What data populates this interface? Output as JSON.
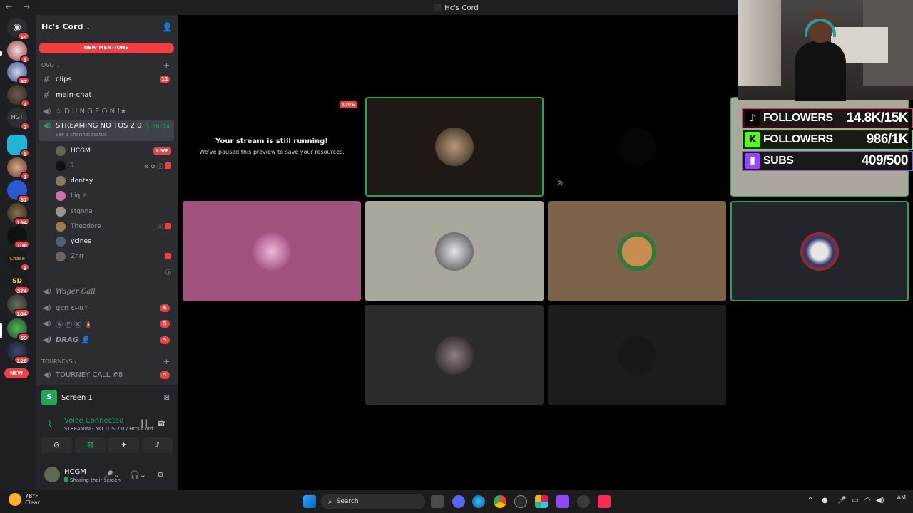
{
  "titlebar": {
    "nav": "← →",
    "title": "Hc's Cord"
  },
  "guilds": {
    "badges": [
      "54",
      "1",
      "97",
      "1",
      "2",
      "1",
      "1",
      "87",
      "194",
      "108",
      "9",
      "374",
      "104",
      "59",
      "126"
    ],
    "new_label": "NEW"
  },
  "server": {
    "name": "Hc's Cord",
    "new_mentions": "NEW MENTIONS",
    "category_ovo": "OVO",
    "category_tourneys": "TOURNEYS",
    "channels": [
      {
        "name": "clips",
        "count": "11"
      },
      {
        "name": "main-chat"
      },
      {
        "name": "☆ D U N G E O N !★"
      }
    ],
    "active_channel": {
      "name": "STREAMING NO TOS 2.0",
      "status": "Set a channel status",
      "timer": "3:00:24"
    },
    "users": [
      {
        "name": "HCGM",
        "live": "LIVE"
      },
      {
        "name": "?"
      },
      {
        "name": "dontay"
      },
      {
        "name": "Liq ⚡"
      },
      {
        "name": "stqnna"
      },
      {
        "name": "Theodore"
      },
      {
        "name": "ycines"
      },
      {
        "name": "Zhrr"
      }
    ],
    "voice_channels": [
      {
        "name": "Wager Call"
      },
      {
        "name": "ցєη εнαт",
        "count": "6"
      },
      {
        "name": "Ⓐ Ⓕ Ⓚ 🧯",
        "count": "5"
      },
      {
        "name": "DRAG 👤",
        "count": "5"
      },
      {
        "name": "TOURNEY CALL #8",
        "count": "4"
      }
    ]
  },
  "panel": {
    "screen_label": "Screen 1",
    "screen_initial": "S",
    "voice_connected": "Voice Connected",
    "voice_location": "STREAMING NO TOS 2.0 / Hc's Cord",
    "username": "HCGM",
    "user_status": "Sharing their screen"
  },
  "stage": {
    "paused_title": "Your stream is still running!",
    "paused_sub": "We've paused this preview to save your resources.",
    "live_tag": "LIVE"
  },
  "stats": [
    {
      "label": "FOLLOWERS",
      "value": "14.8K/15K",
      "logo": "♪",
      "color": "#fe2c55"
    },
    {
      "label": "FOLLOWERS",
      "value": "986/1K",
      "logo": "K",
      "color": "#53fc18"
    },
    {
      "label": "SUBS",
      "value": "409/500",
      "logo": "▮",
      "color": "#9146ff"
    }
  ],
  "taskbar": {
    "temp": "78°F",
    "weather": "Clear",
    "search": "Search",
    "time": "AM"
  },
  "colors": {
    "accent_red": "#f23f43",
    "online_green": "#23a55a",
    "bg_dark": "#1e1f22"
  }
}
